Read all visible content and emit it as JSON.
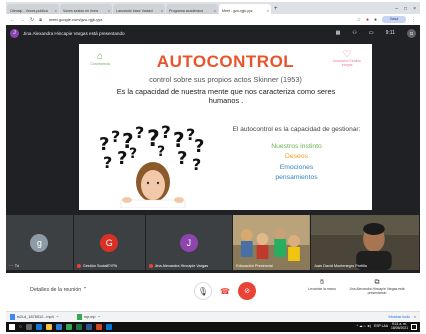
{
  "browser": {
    "tabs": [
      {
        "label": "Otimaip - Voces publica"
      },
      {
        "label": "Voces sesión en línea"
      },
      {
        "label": "Lanzando base Vaclavi"
      },
      {
        "label": "Programa académico"
      },
      {
        "label": "Meet - gzu-rgjk-yyz",
        "active": true
      }
    ],
    "new_tab": "+",
    "url": "meet.google.com/gzu-rgjk-yyz",
    "profile_label": "Gasa"
  },
  "meet": {
    "presenter_initial": "J",
    "presenter_banner": "Jina Alexandra Hincapie Vargas está presentando",
    "time": "9:11",
    "self_initial": "G"
  },
  "slide": {
    "logo_left": "Convivencia",
    "logo_right": "Asociación Familiar Integral",
    "title": "AUTOCONTROL",
    "subtitle": "control sobre sus propios actos Skinner (1953)",
    "body": "Es la capacidad de nuestra mente que  nos caracteriza como seres humanos .",
    "right_intro": "El autocontrol es la capacidad de gestionar:",
    "items": [
      {
        "text": "Nuestros instinto",
        "color": "#6ab04c"
      },
      {
        "text": "Deseos",
        "color": "#f0a020"
      },
      {
        "text": "Emociones",
        "color": "#2e86c1"
      },
      {
        "text": "pensamientos",
        "color": "#2e86c1"
      }
    ]
  },
  "participants": [
    {
      "initial": "g",
      "name": "Tú",
      "color": "#8e9aa6"
    },
    {
      "initial": "G",
      "name": "Gestión SocialEYPA",
      "color": "#d93025"
    },
    {
      "initial": "J",
      "name": "Jina Alexandra Hincapie Vargas",
      "color": "#8e44ad"
    },
    {
      "initial": "",
      "name": "Educación Presencial"
    },
    {
      "initial": "",
      "name": "Juan David Montenegro Portilla"
    }
  ],
  "bottom": {
    "details_label": "Detalles de la reunión",
    "raise_label": "Levantar la mano",
    "presenting_label": "Jina Alexandra Hincapie Vargas está presentando"
  },
  "downloads": {
    "file": "ts2Ld_1876512...mp4",
    "file2": "mp.mp",
    "show_all": "Mostrar todo"
  },
  "taskbar": {
    "lang": "ESP LAA",
    "time": "9:11 a. m.",
    "date": "18/05/2021"
  }
}
